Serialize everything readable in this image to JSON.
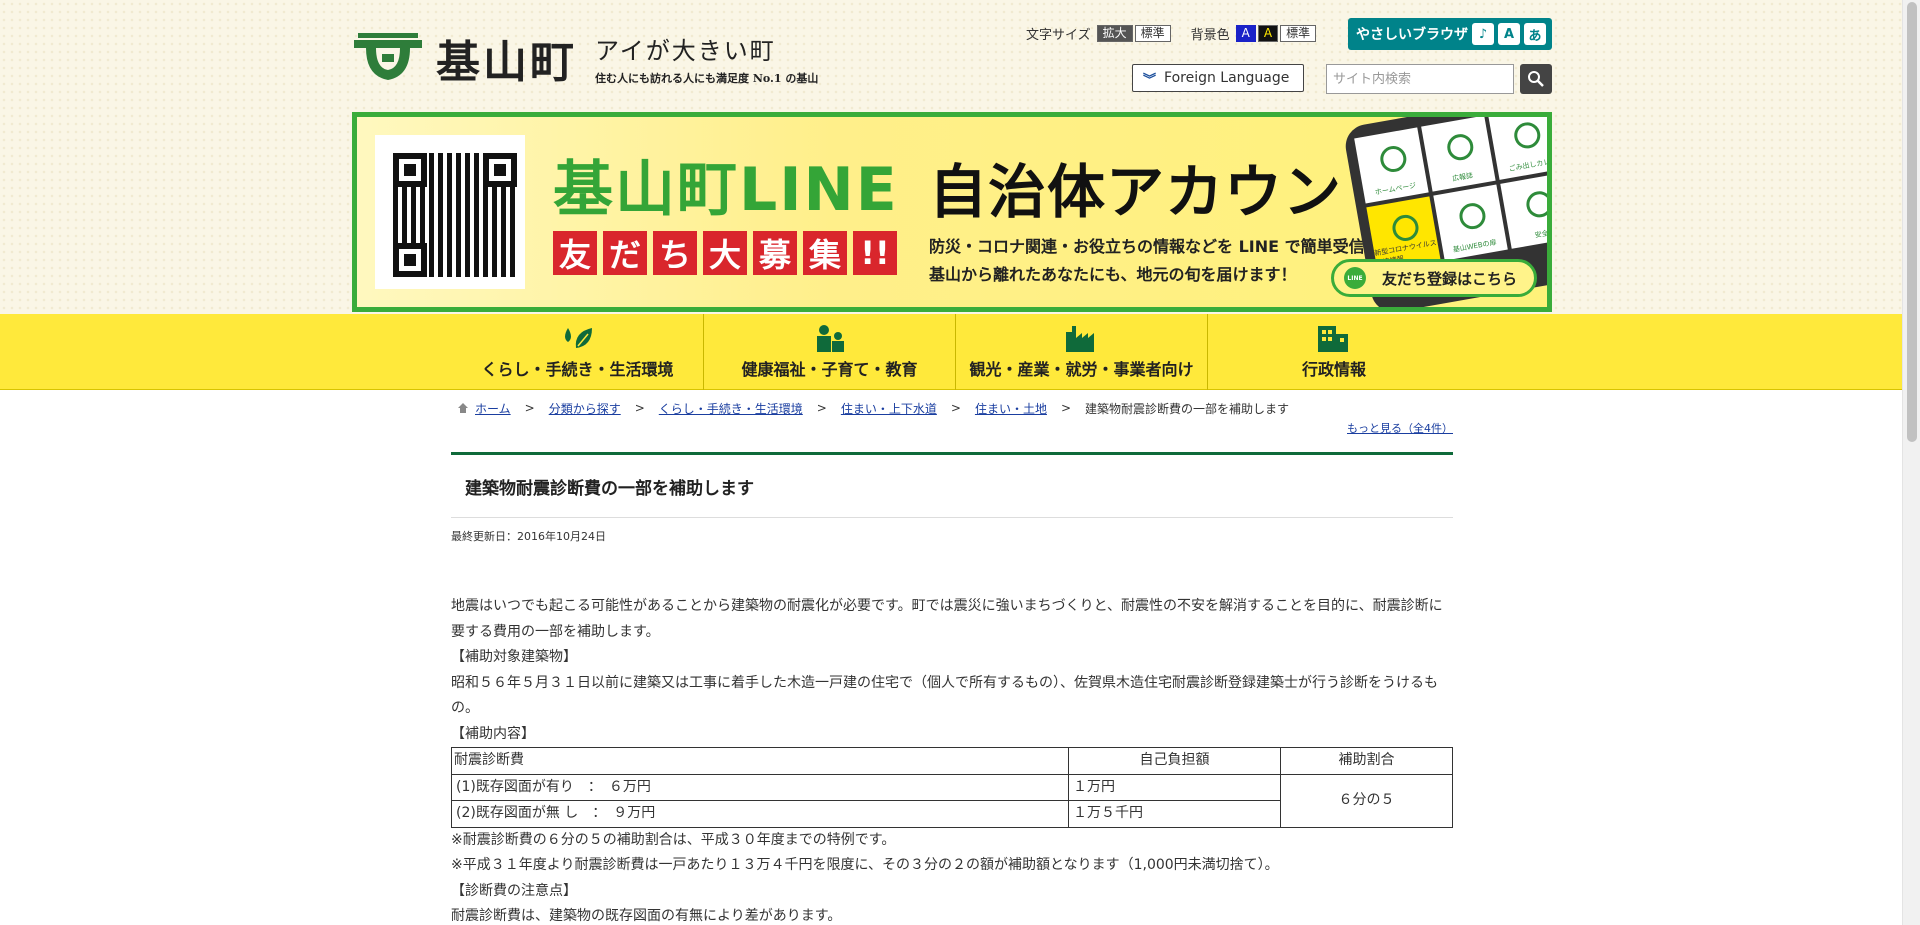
{
  "header": {
    "logo_name": "基山町",
    "catch": "アイが大きい町",
    "sub": "住む人にも訪れる人にも満足度 No.1 の基山",
    "font_size_label": "文字サイズ",
    "font_large": "拡大",
    "font_normal": "標準",
    "bg_label": "背景色",
    "bg_blue": "A",
    "bg_black": "A",
    "bg_normal": "標準",
    "yasashii": "やさしいブラウザ",
    "yasashii_icons": [
      "♪",
      "A",
      "あ"
    ],
    "foreign": "Foreign Language",
    "search_placeholder": "サイト内検索"
  },
  "banner": {
    "title_green": "基山町LINE",
    "title_black": "自治体アカウント",
    "boshu": [
      "友",
      "だ",
      "ち",
      "大",
      "募",
      "集",
      "!!"
    ],
    "line1": "防災・コロナ関連・お役立ちの情報などを LINE で簡単受信！",
    "line2": "基山から離れたあなたにも、地元の旬を届けます！",
    "friend_btn": "友だち登録はこちら",
    "line_icon": "LINE",
    "phone_cells": [
      "ホームページ",
      "広報誌",
      "ごみ出しカレ",
      "新型コロナウイルス関連情報",
      "基山WEBの扉",
      "安全"
    ]
  },
  "gnav": [
    {
      "label": "くらし・手続き・生活環境",
      "icon": "leaf-drop-icon"
    },
    {
      "label": "健康福祉・子育て・教育",
      "icon": "people-icon"
    },
    {
      "label": "観光・産業・就労・事業者向け",
      "icon": "factory-icon"
    },
    {
      "label": "行政情報",
      "icon": "building-icon"
    }
  ],
  "breadcrumb": {
    "items": [
      "ホーム",
      "分類から探す",
      "くらし・手続き・生活環境",
      "住まい・上下水道",
      "住まい・土地"
    ],
    "current": "建築物耐震診断費の一部を補助します",
    "more": "もっと見る（全4件）"
  },
  "page": {
    "title": "建築物耐震診断費の一部を補助します",
    "updated": "最終更新日：2016年10月24日",
    "p1": "地震はいつでも起こる可能性があることから建築物の耐震化が必要です。町では震災に強いまちづくりと、耐震性の不安を解消することを目的に、耐震診断に要する費用の一部を補助します。",
    "h_target": "【補助対象建築物】",
    "p2": "昭和５６年５月３１日以前に建築又は工事に着手した木造一戸建の住宅で（個人で所有するもの）、佐賀県木造住宅耐震診断登録建築士が行う診断をうけるもの。",
    "h_content": "【補助内容】",
    "note1": "※耐震診断費の６分の５の補助割合は、平成３０年度までの特例です。",
    "note2": "※平成３１年度より耐震診断費は一戸あたり１３万４千円を限度に、その３分の２の額が補助額となります（1,000円未満切捨て）。",
    "h_notice": "【診断費の注意点】",
    "p3": "耐震診断費は、建築物の既存図面の有無により差があります。"
  },
  "table": {
    "headers": [
      "耐震診断費",
      "自己負担額",
      "補助割合"
    ],
    "rows": [
      {
        "item": "(1)既存図面が有り　：　６万円",
        "self": "１万円"
      },
      {
        "item": "(2)既存図面が無 し　：　９万円",
        "self": "１万５千円"
      }
    ],
    "ratio": "６分の５"
  }
}
